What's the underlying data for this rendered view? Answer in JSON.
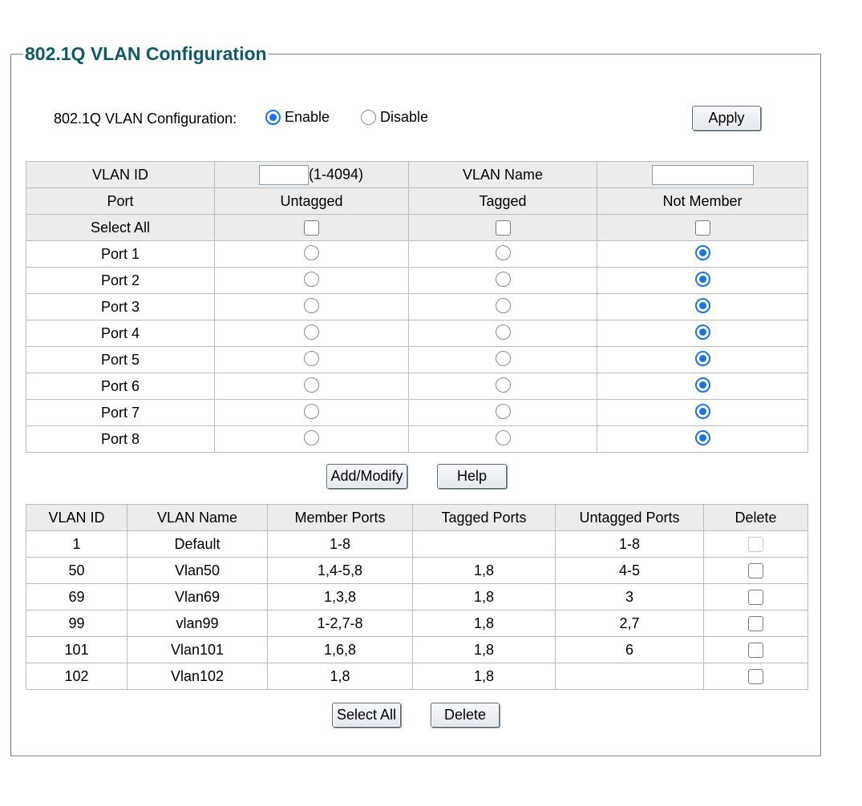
{
  "title": "802.1Q VLAN Configuration",
  "config": {
    "label": "802.1Q VLAN Configuration:",
    "enable_label": "Enable",
    "disable_label": "Disable",
    "selected": "Enable",
    "apply_label": "Apply"
  },
  "form": {
    "vlan_id_label": "VLAN ID",
    "vlan_id_value": "",
    "vlan_id_range": "(1-4094)",
    "vlan_name_label": "VLAN Name",
    "vlan_name_value": "",
    "headers": [
      "Port",
      "Untagged",
      "Tagged",
      "Not Member"
    ],
    "select_all_label": "Select All",
    "ports": [
      {
        "name": "Port 1",
        "state": "Not Member"
      },
      {
        "name": "Port 2",
        "state": "Not Member"
      },
      {
        "name": "Port 3",
        "state": "Not Member"
      },
      {
        "name": "Port 4",
        "state": "Not Member"
      },
      {
        "name": "Port 5",
        "state": "Not Member"
      },
      {
        "name": "Port 6",
        "state": "Not Member"
      },
      {
        "name": "Port 7",
        "state": "Not Member"
      },
      {
        "name": "Port 8",
        "state": "Not Member"
      }
    ],
    "add_modify_label": "Add/Modify",
    "help_label": "Help"
  },
  "vlan_table": {
    "headers": [
      "VLAN ID",
      "VLAN Name",
      "Member Ports",
      "Tagged Ports",
      "Untagged Ports",
      "Delete"
    ],
    "rows": [
      {
        "id": "1",
        "name": "Default",
        "member": "1-8",
        "tagged": "",
        "untagged": "1-8",
        "deletable": false
      },
      {
        "id": "50",
        "name": "Vlan50",
        "member": "1,4-5,8",
        "tagged": "1,8",
        "untagged": "4-5",
        "deletable": true
      },
      {
        "id": "69",
        "name": "Vlan69",
        "member": "1,3,8",
        "tagged": "1,8",
        "untagged": "3",
        "deletable": true
      },
      {
        "id": "99",
        "name": "vlan99",
        "member": "1-2,7-8",
        "tagged": "1,8",
        "untagged": "2,7",
        "deletable": true
      },
      {
        "id": "101",
        "name": "Vlan101",
        "member": "1,6,8",
        "tagged": "1,8",
        "untagged": "6",
        "deletable": true
      },
      {
        "id": "102",
        "name": "Vlan102",
        "member": "1,8",
        "tagged": "1,8",
        "untagged": "",
        "deletable": true
      }
    ],
    "select_all_label": "Select All",
    "delete_label": "Delete"
  },
  "colors": {
    "title": "#0e5a66",
    "radio_selected": "#1a73e8",
    "header_bg": "#ececec"
  }
}
